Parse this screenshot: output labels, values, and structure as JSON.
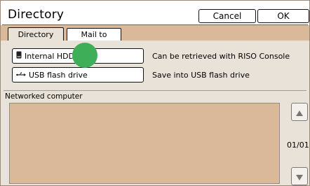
{
  "header": {
    "title": "Directory",
    "cancel_label": "Cancel",
    "ok_label": "OK"
  },
  "tabs": [
    {
      "label": "Directory",
      "active": true
    },
    {
      "label": "Mail to",
      "active": false
    }
  ],
  "destinations": [
    {
      "label": "Internal HDD",
      "icon": "hdd-icon",
      "description": "Can be retrieved with RISO Console"
    },
    {
      "label": "USB flash drive",
      "icon": "usb-icon",
      "description": "Save into USB flash drive"
    }
  ],
  "networked": {
    "label": "Networked computer",
    "page_indicator": "01/01"
  },
  "colors": {
    "background_tan": "#d9b99a",
    "content_gray": "#e9e2d8",
    "cursor_green": "#3fae59"
  }
}
